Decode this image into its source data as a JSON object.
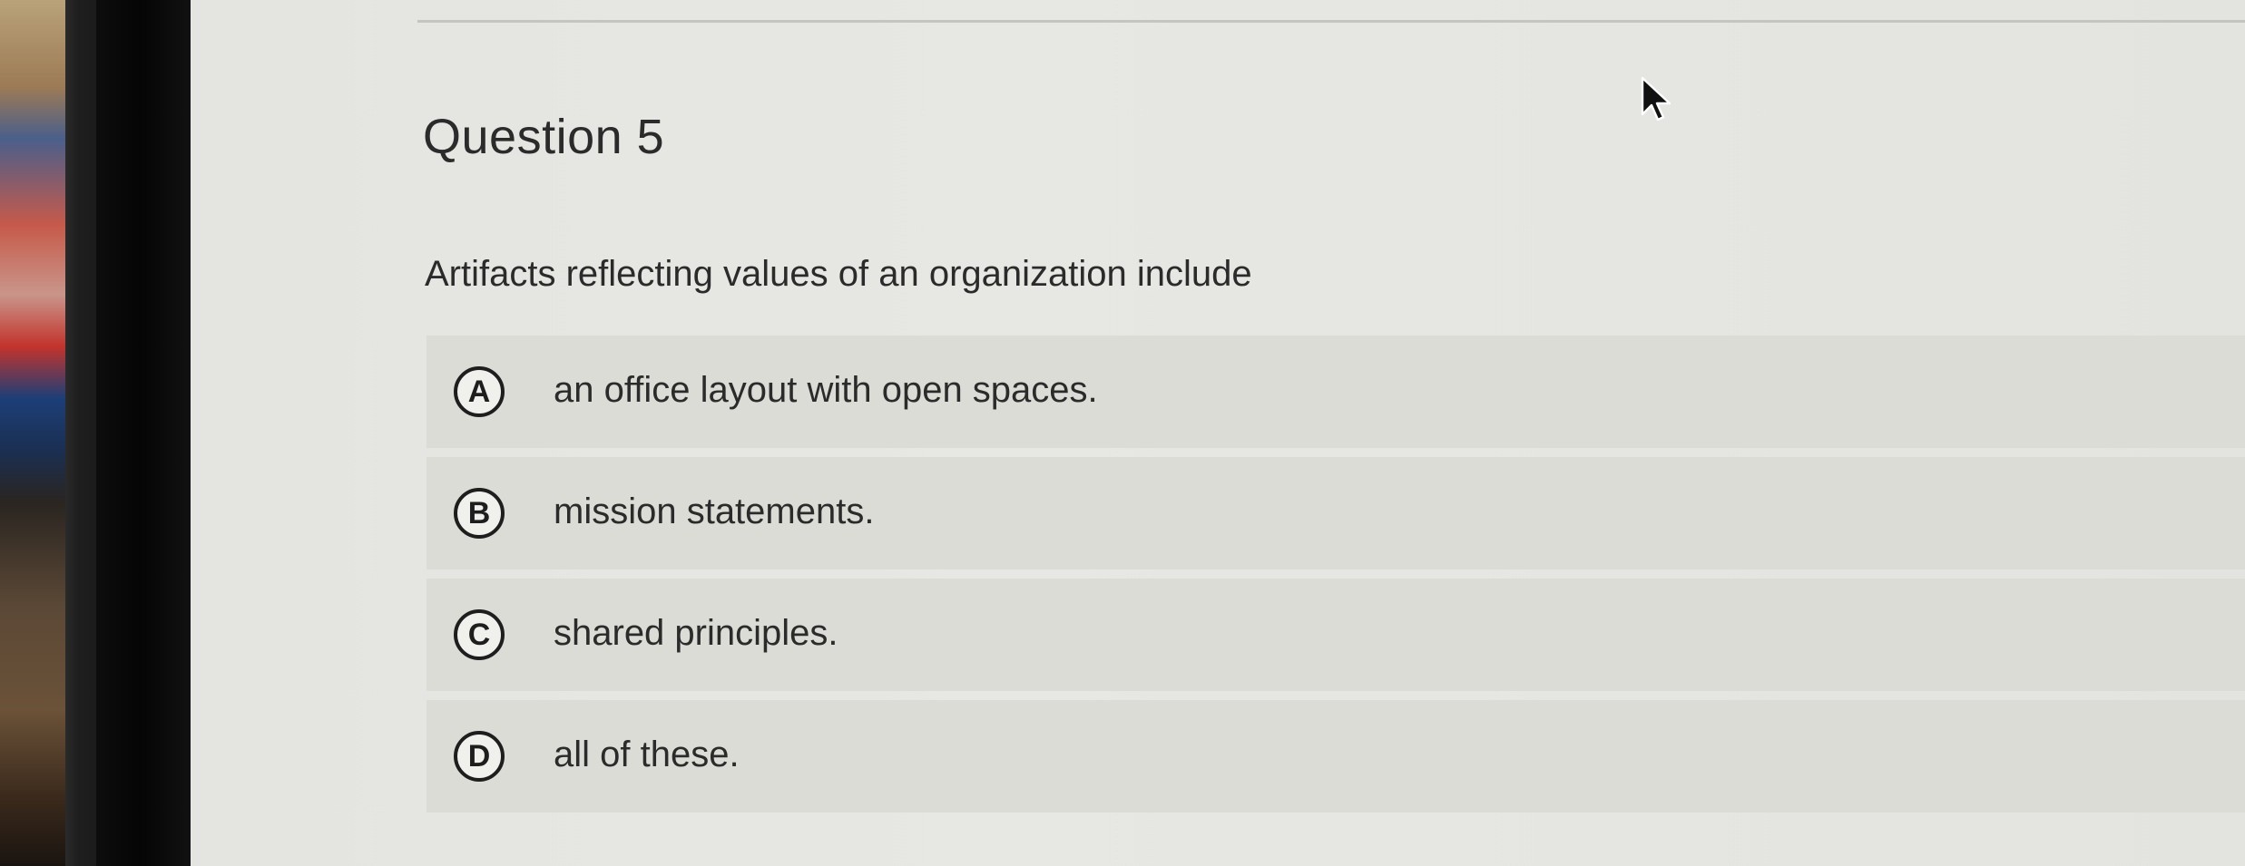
{
  "question": {
    "title": "Question 5",
    "prompt": "Artifacts reflecting values of an organization include"
  },
  "options": [
    {
      "letter": "A",
      "text": "an office layout with open spaces."
    },
    {
      "letter": "B",
      "text": "mission statements."
    },
    {
      "letter": "C",
      "text": "shared principles."
    },
    {
      "letter": "D",
      "text": "all of these."
    }
  ],
  "icons": {
    "cursor": "mouse-pointer-icon"
  },
  "colors": {
    "screen_background": "#e4e4e0",
    "option_background": "#dcdcd7",
    "text": "#2b2b2b",
    "letter_border": "#1e1e1e"
  }
}
